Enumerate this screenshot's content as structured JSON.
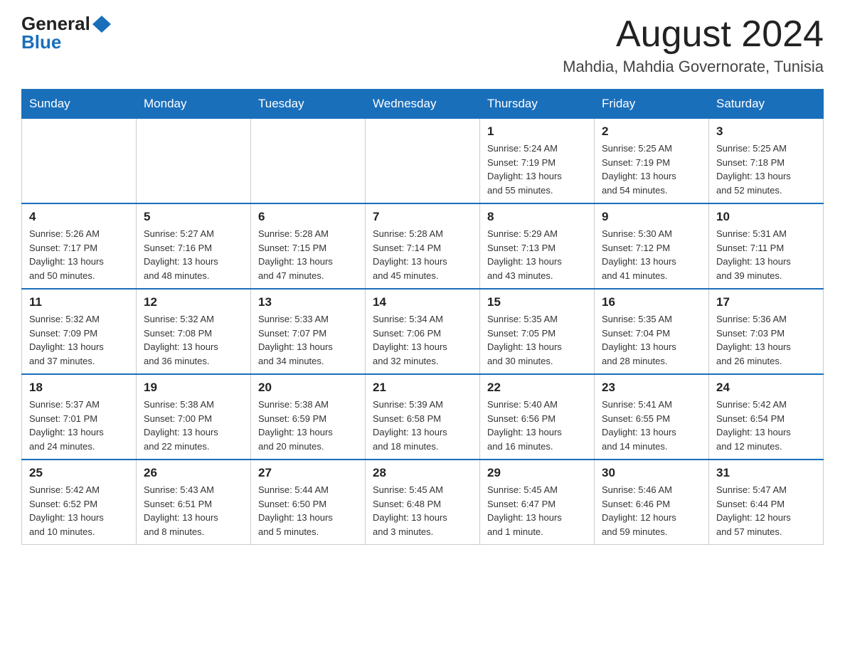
{
  "header": {
    "logo_general": "General",
    "logo_blue": "Blue",
    "month_title": "August 2024",
    "location": "Mahdia, Mahdia Governorate, Tunisia"
  },
  "days_of_week": [
    "Sunday",
    "Monday",
    "Tuesday",
    "Wednesday",
    "Thursday",
    "Friday",
    "Saturday"
  ],
  "weeks": [
    [
      {
        "day": "",
        "info": ""
      },
      {
        "day": "",
        "info": ""
      },
      {
        "day": "",
        "info": ""
      },
      {
        "day": "",
        "info": ""
      },
      {
        "day": "1",
        "info": "Sunrise: 5:24 AM\nSunset: 7:19 PM\nDaylight: 13 hours\nand 55 minutes."
      },
      {
        "day": "2",
        "info": "Sunrise: 5:25 AM\nSunset: 7:19 PM\nDaylight: 13 hours\nand 54 minutes."
      },
      {
        "day": "3",
        "info": "Sunrise: 5:25 AM\nSunset: 7:18 PM\nDaylight: 13 hours\nand 52 minutes."
      }
    ],
    [
      {
        "day": "4",
        "info": "Sunrise: 5:26 AM\nSunset: 7:17 PM\nDaylight: 13 hours\nand 50 minutes."
      },
      {
        "day": "5",
        "info": "Sunrise: 5:27 AM\nSunset: 7:16 PM\nDaylight: 13 hours\nand 48 minutes."
      },
      {
        "day": "6",
        "info": "Sunrise: 5:28 AM\nSunset: 7:15 PM\nDaylight: 13 hours\nand 47 minutes."
      },
      {
        "day": "7",
        "info": "Sunrise: 5:28 AM\nSunset: 7:14 PM\nDaylight: 13 hours\nand 45 minutes."
      },
      {
        "day": "8",
        "info": "Sunrise: 5:29 AM\nSunset: 7:13 PM\nDaylight: 13 hours\nand 43 minutes."
      },
      {
        "day": "9",
        "info": "Sunrise: 5:30 AM\nSunset: 7:12 PM\nDaylight: 13 hours\nand 41 minutes."
      },
      {
        "day": "10",
        "info": "Sunrise: 5:31 AM\nSunset: 7:11 PM\nDaylight: 13 hours\nand 39 minutes."
      }
    ],
    [
      {
        "day": "11",
        "info": "Sunrise: 5:32 AM\nSunset: 7:09 PM\nDaylight: 13 hours\nand 37 minutes."
      },
      {
        "day": "12",
        "info": "Sunrise: 5:32 AM\nSunset: 7:08 PM\nDaylight: 13 hours\nand 36 minutes."
      },
      {
        "day": "13",
        "info": "Sunrise: 5:33 AM\nSunset: 7:07 PM\nDaylight: 13 hours\nand 34 minutes."
      },
      {
        "day": "14",
        "info": "Sunrise: 5:34 AM\nSunset: 7:06 PM\nDaylight: 13 hours\nand 32 minutes."
      },
      {
        "day": "15",
        "info": "Sunrise: 5:35 AM\nSunset: 7:05 PM\nDaylight: 13 hours\nand 30 minutes."
      },
      {
        "day": "16",
        "info": "Sunrise: 5:35 AM\nSunset: 7:04 PM\nDaylight: 13 hours\nand 28 minutes."
      },
      {
        "day": "17",
        "info": "Sunrise: 5:36 AM\nSunset: 7:03 PM\nDaylight: 13 hours\nand 26 minutes."
      }
    ],
    [
      {
        "day": "18",
        "info": "Sunrise: 5:37 AM\nSunset: 7:01 PM\nDaylight: 13 hours\nand 24 minutes."
      },
      {
        "day": "19",
        "info": "Sunrise: 5:38 AM\nSunset: 7:00 PM\nDaylight: 13 hours\nand 22 minutes."
      },
      {
        "day": "20",
        "info": "Sunrise: 5:38 AM\nSunset: 6:59 PM\nDaylight: 13 hours\nand 20 minutes."
      },
      {
        "day": "21",
        "info": "Sunrise: 5:39 AM\nSunset: 6:58 PM\nDaylight: 13 hours\nand 18 minutes."
      },
      {
        "day": "22",
        "info": "Sunrise: 5:40 AM\nSunset: 6:56 PM\nDaylight: 13 hours\nand 16 minutes."
      },
      {
        "day": "23",
        "info": "Sunrise: 5:41 AM\nSunset: 6:55 PM\nDaylight: 13 hours\nand 14 minutes."
      },
      {
        "day": "24",
        "info": "Sunrise: 5:42 AM\nSunset: 6:54 PM\nDaylight: 13 hours\nand 12 minutes."
      }
    ],
    [
      {
        "day": "25",
        "info": "Sunrise: 5:42 AM\nSunset: 6:52 PM\nDaylight: 13 hours\nand 10 minutes."
      },
      {
        "day": "26",
        "info": "Sunrise: 5:43 AM\nSunset: 6:51 PM\nDaylight: 13 hours\nand 8 minutes."
      },
      {
        "day": "27",
        "info": "Sunrise: 5:44 AM\nSunset: 6:50 PM\nDaylight: 13 hours\nand 5 minutes."
      },
      {
        "day": "28",
        "info": "Sunrise: 5:45 AM\nSunset: 6:48 PM\nDaylight: 13 hours\nand 3 minutes."
      },
      {
        "day": "29",
        "info": "Sunrise: 5:45 AM\nSunset: 6:47 PM\nDaylight: 13 hours\nand 1 minute."
      },
      {
        "day": "30",
        "info": "Sunrise: 5:46 AM\nSunset: 6:46 PM\nDaylight: 12 hours\nand 59 minutes."
      },
      {
        "day": "31",
        "info": "Sunrise: 5:47 AM\nSunset: 6:44 PM\nDaylight: 12 hours\nand 57 minutes."
      }
    ]
  ]
}
